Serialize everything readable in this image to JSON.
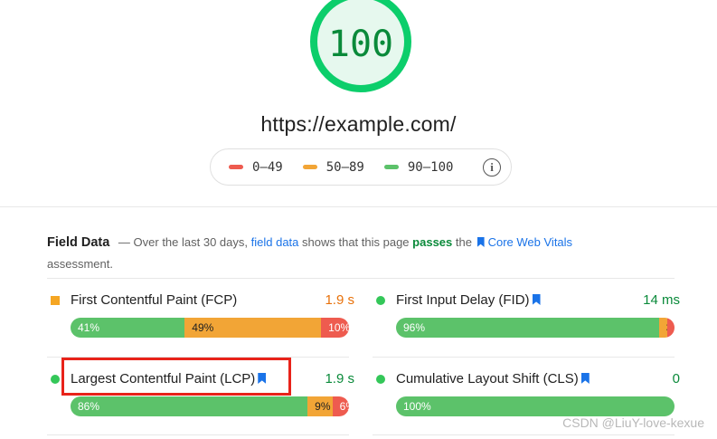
{
  "score": {
    "value": "100",
    "fraction": 1.0,
    "color": "#0cce6b"
  },
  "url": "https://example.com/",
  "legend": {
    "items": [
      {
        "label": "0–49",
        "color": "#ee5b4f"
      },
      {
        "label": "50–89",
        "color": "#f2a536"
      },
      {
        "label": "90–100",
        "color": "#5cc26a"
      }
    ],
    "info_icon": "i"
  },
  "field_data": {
    "title": "Field Data",
    "text_1": "— Over the last 30 days,",
    "link_field": "field data",
    "text_2": "shows that this page",
    "passes": "passes",
    "text_3": "the",
    "link_cwv": "Core Web Vitals",
    "text_4": "assessment."
  },
  "metrics": [
    {
      "name": "First Contentful Paint (FCP)",
      "value": "1.9 s",
      "status": "average",
      "dist": [
        {
          "label": "41%",
          "pct": 41
        },
        {
          "label": "49%",
          "pct": 49
        },
        {
          "label": "10%",
          "pct": 10
        }
      ]
    },
    {
      "name": "First Input Delay (FID)",
      "value": "14 ms",
      "status": "good",
      "core": true,
      "dist": [
        {
          "label": "96%",
          "pct": 96
        },
        {
          "label": "3%",
          "pct": 3
        },
        {
          "label": "1%",
          "pct": 1
        }
      ]
    },
    {
      "name": "Largest Contentful Paint (LCP)",
      "value": "1.9 s",
      "status": "good",
      "core": true,
      "dist": [
        {
          "label": "86%",
          "pct": 86
        },
        {
          "label": "9%",
          "pct": 9
        },
        {
          "label": "6%",
          "pct": 6
        }
      ]
    },
    {
      "name": "Cumulative Layout Shift (CLS)",
      "value": "0",
      "status": "good",
      "core": true,
      "dist": [
        {
          "label": "100%",
          "pct": 100
        },
        {
          "label": "",
          "pct": 0
        },
        {
          "label": "",
          "pct": 0
        }
      ]
    }
  ],
  "watermark": "CSDN @LiuY-love-kexue"
}
